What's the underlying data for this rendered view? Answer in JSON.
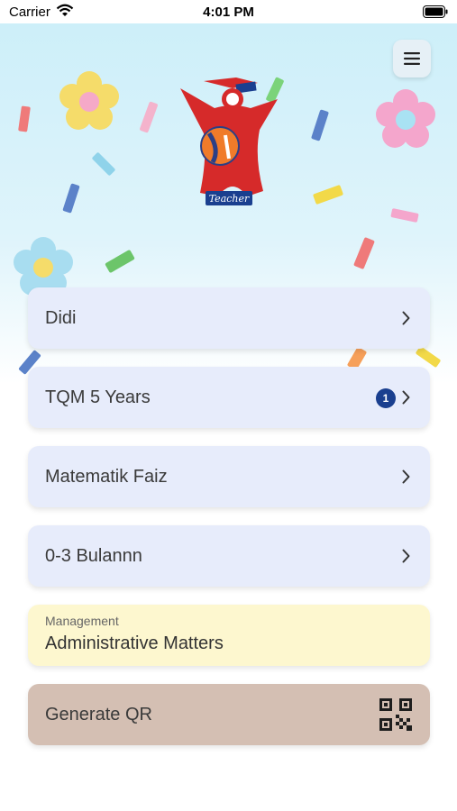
{
  "status_bar": {
    "carrier": "Carrier",
    "time": "4:01 PM"
  },
  "logo": {
    "caption": "Teacher"
  },
  "menu": {
    "icon": "hamburger-menu-icon"
  },
  "items": [
    {
      "label": "Didi",
      "badge": ""
    },
    {
      "label": "TQM 5 Years",
      "badge": "1"
    },
    {
      "label": "Matematik Faiz",
      "badge": ""
    },
    {
      "label": "0-3 Bulannn",
      "badge": ""
    }
  ],
  "management": {
    "section": "Management",
    "label": "Administrative Matters"
  },
  "qr": {
    "label": "Generate QR",
    "icon": "qr-code-icon"
  },
  "colors": {
    "card": "#e7ecfb",
    "management_card": "#fdf7cf",
    "qr_card": "#d4bfb3",
    "badge": "#1a3f8f",
    "logo_red": "#d62a2a"
  }
}
